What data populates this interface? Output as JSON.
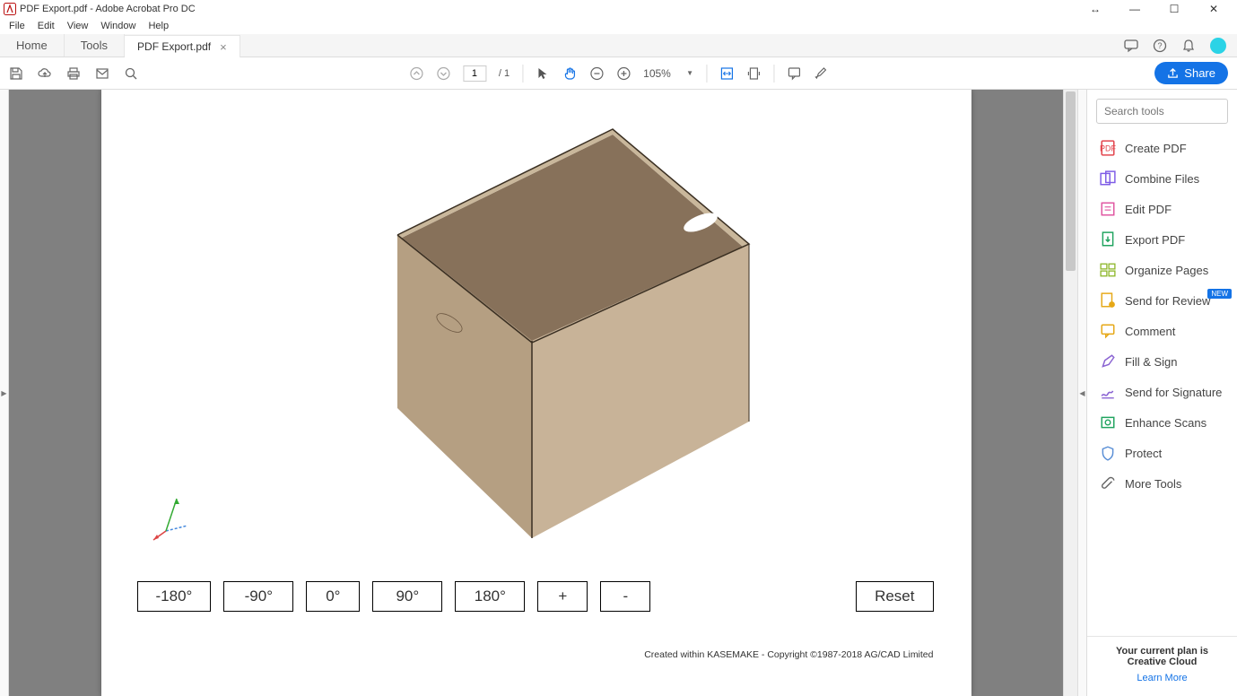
{
  "titlebar": {
    "title": "PDF Export.pdf - Adobe Acrobat Pro DC"
  },
  "menubar": {
    "items": [
      "File",
      "Edit",
      "View",
      "Window",
      "Help"
    ]
  },
  "tabrow": {
    "home": "Home",
    "tools": "Tools",
    "doc_tab": "PDF Export.pdf"
  },
  "toolbar": {
    "page_current": "1",
    "page_total": "/ 1",
    "zoom": "105%",
    "share": "Share"
  },
  "pdf": {
    "angle_btns": [
      "-180°",
      "-90°",
      "0°",
      "90°",
      "180°",
      "+",
      "-"
    ],
    "reset": "Reset",
    "footer": "Created within KASEMAKE - Copyright ©1987-2018 AG/CAD Limited"
  },
  "tools_panel": {
    "search_placeholder": "Search tools",
    "items": [
      {
        "label": "Create PDF",
        "color": "#e34850",
        "badge": ""
      },
      {
        "label": "Combine Files",
        "color": "#7e5ce6",
        "badge": ""
      },
      {
        "label": "Edit PDF",
        "color": "#e055a0",
        "badge": ""
      },
      {
        "label": "Export PDF",
        "color": "#1fa35e",
        "badge": ""
      },
      {
        "label": "Organize Pages",
        "color": "#8fb82e",
        "badge": ""
      },
      {
        "label": "Send for Review",
        "color": "#e6a817",
        "badge": "NEW"
      },
      {
        "label": "Comment",
        "color": "#e6a817",
        "badge": ""
      },
      {
        "label": "Fill & Sign",
        "color": "#8a63d2",
        "badge": ""
      },
      {
        "label": "Send for Signature",
        "color": "#8a63d2",
        "badge": ""
      },
      {
        "label": "Enhance Scans",
        "color": "#1fa35e",
        "badge": ""
      },
      {
        "label": "Protect",
        "color": "#5a8fd6",
        "badge": ""
      },
      {
        "label": "More Tools",
        "color": "#666666",
        "badge": ""
      }
    ],
    "plan_text": "Your current plan is Creative Cloud",
    "learn_more": "Learn More"
  }
}
